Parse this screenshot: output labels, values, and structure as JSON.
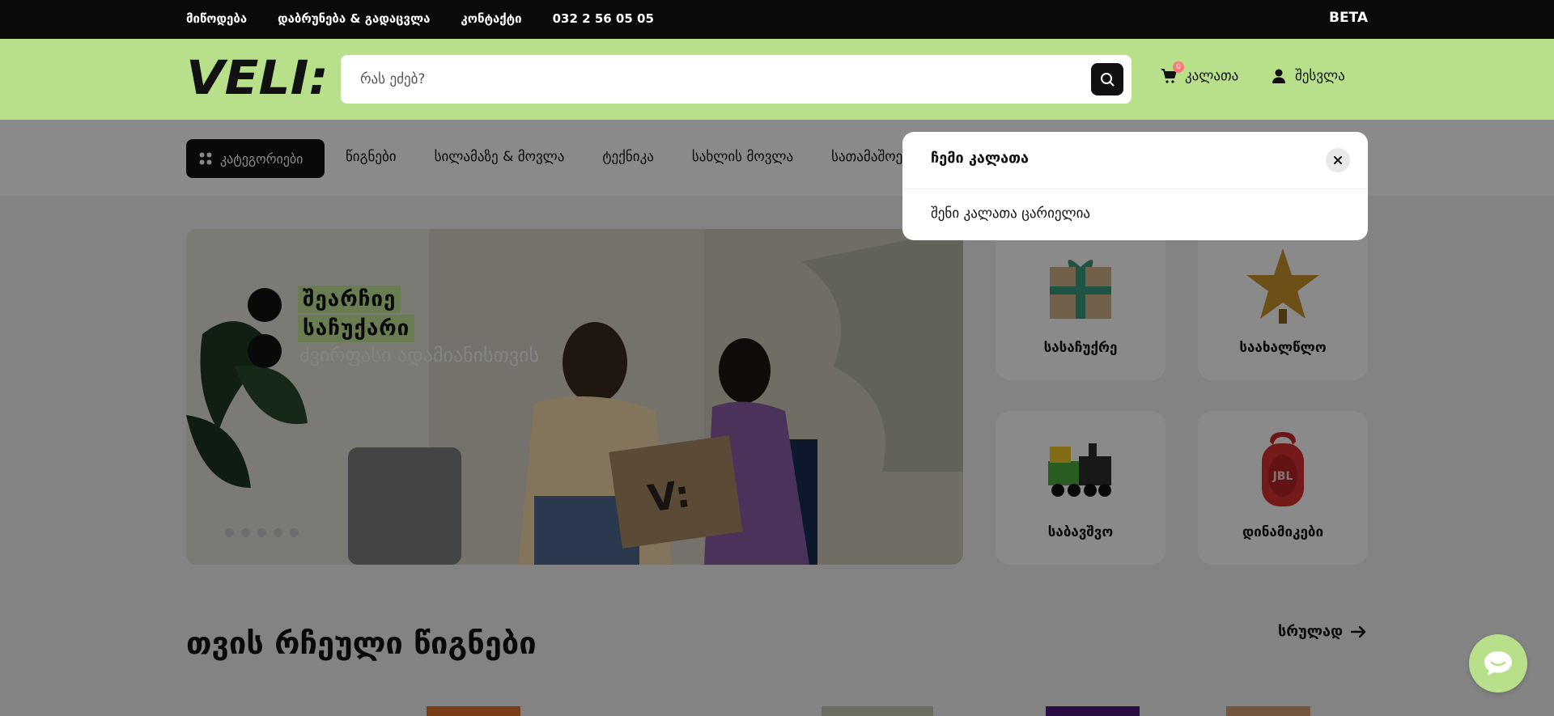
{
  "topbar": {
    "links": [
      "მიწოდება",
      "დაბრუნება & გადაცვლა",
      "კონტაქტი",
      "032 2 56 05 05"
    ],
    "beta": "BETA"
  },
  "header": {
    "logo_text": "VELI:",
    "search_placeholder": "რას ეძებ?",
    "cart_label": "კალათა",
    "cart_count": "0",
    "login_label": "შესვლა"
  },
  "nav": {
    "categories_label": "კატეგორიები",
    "items": [
      "წიგნები",
      "სილამაზე & მოვლა",
      "ტექნიკა",
      "სახლის მოვლა",
      "სათამაშოები"
    ]
  },
  "hero": {
    "line1": "შეარჩიე",
    "line2": "საჩუქარი",
    "subtitle": "ძვირფასი ადამიანისთვის",
    "slides": 5
  },
  "tiles": [
    {
      "label": "სასაჩუქრე",
      "icon": "gift-box-icon"
    },
    {
      "label": "საახალწლო",
      "icon": "star-icon"
    },
    {
      "label": "საბავშვო",
      "icon": "toy-train-icon"
    },
    {
      "label": "დინამიკები",
      "icon": "speaker-icon"
    }
  ],
  "section": {
    "title": "თვის რჩეული წიგნები",
    "see_all": "სრულად"
  },
  "cart_popup": {
    "title": "ჩემი კალათა",
    "empty_text": "შენი კალათა ცარიელია"
  },
  "colors": {
    "accent": "#b8e08a",
    "topbar": "#0a0a0a",
    "badge": "#ff7777"
  }
}
